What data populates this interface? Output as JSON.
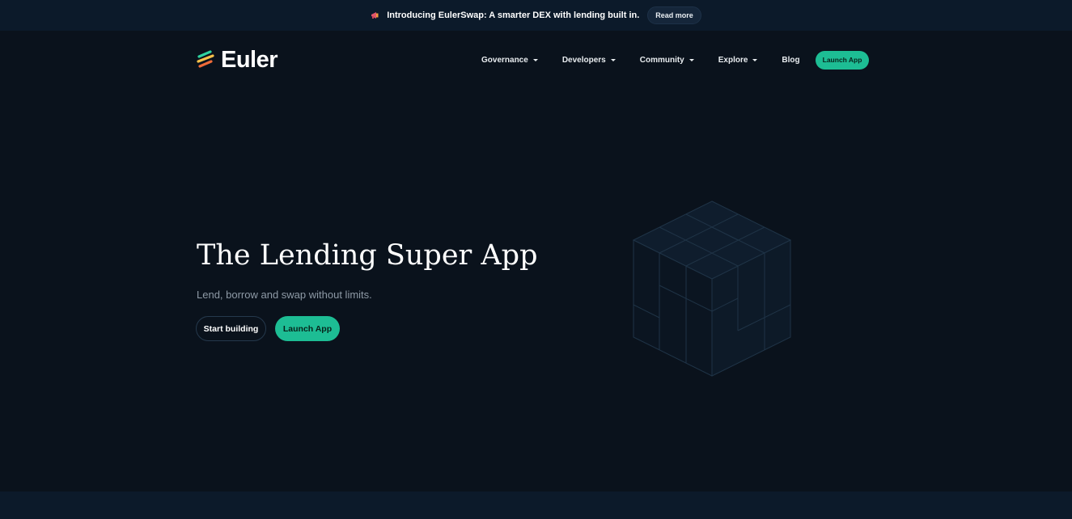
{
  "announcement": {
    "icon": "megaphone-icon",
    "text": "Introducing EulerSwap: A smarter DEX with lending built in.",
    "read_more_label": "Read more"
  },
  "header": {
    "logo_text": "Euler",
    "nav": [
      {
        "label": "Governance",
        "dropdown": true
      },
      {
        "label": "Developers",
        "dropdown": true
      },
      {
        "label": "Community",
        "dropdown": true
      },
      {
        "label": "Explore",
        "dropdown": true
      },
      {
        "label": "Blog",
        "dropdown": false
      }
    ],
    "launch_label": "Launch App"
  },
  "hero": {
    "title": "The Lending Super App",
    "subtitle": "Lend, borrow and swap without limits.",
    "start_label": "Start building",
    "launch_label": "Launch App"
  },
  "colors": {
    "background": "#0a121c",
    "band": "#0c1a2a",
    "accent": "#1dbd94",
    "logo_green": "#2ed3a0",
    "logo_yellow": "#f5c04a",
    "logo_orange": "#ef6b39"
  }
}
